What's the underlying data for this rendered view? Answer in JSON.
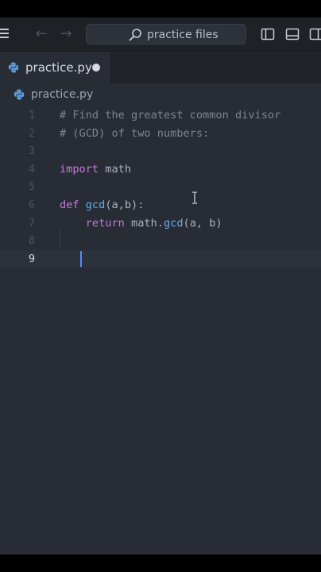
{
  "titlebar": {
    "search_label": "practice files",
    "icons": [
      "menu-icon",
      "back-arrow-icon",
      "forward-arrow-icon",
      "search-icon",
      "toggle-left-panel-icon",
      "toggle-bottom-panel-icon",
      "toggle-right-panel-icon"
    ]
  },
  "tab": {
    "label": "practice.py",
    "modified": true,
    "icon": "python-file-icon"
  },
  "breadcrumb": {
    "label": "practice.py"
  },
  "editor": {
    "current_line": "9",
    "lines": [
      {
        "n": "1",
        "tokens": [
          {
            "t": "# Find the greatest common divisor",
            "c": "comment"
          }
        ]
      },
      {
        "n": "2",
        "tokens": [
          {
            "t": "# (GCD) of two numbers:",
            "c": "comment"
          }
        ]
      },
      {
        "n": "3",
        "tokens": []
      },
      {
        "n": "4",
        "tokens": [
          {
            "t": "import",
            "c": "keyword"
          },
          {
            "t": " math",
            "c": "plain"
          }
        ]
      },
      {
        "n": "5",
        "tokens": []
      },
      {
        "n": "6",
        "tokens": [
          {
            "t": "def",
            "c": "keyword"
          },
          {
            "t": " ",
            "c": "plain"
          },
          {
            "t": "gcd",
            "c": "func"
          },
          {
            "t": "(a,b):",
            "c": "plain"
          }
        ]
      },
      {
        "n": "7",
        "tokens": [
          {
            "t": "    ",
            "c": "plain"
          },
          {
            "t": "return",
            "c": "keyword"
          },
          {
            "t": " math.",
            "c": "plain"
          },
          {
            "t": "gcd",
            "c": "func"
          },
          {
            "t": "(a, b)",
            "c": "plain"
          }
        ]
      },
      {
        "n": "8",
        "tokens": []
      },
      {
        "n": "9",
        "tokens": []
      }
    ]
  },
  "colors": {
    "background": "#282c34",
    "chrome": "#21252b",
    "comment": "#7f848e",
    "keyword": "#c678dd",
    "function": "#61afef",
    "cursor": "#528bff"
  }
}
